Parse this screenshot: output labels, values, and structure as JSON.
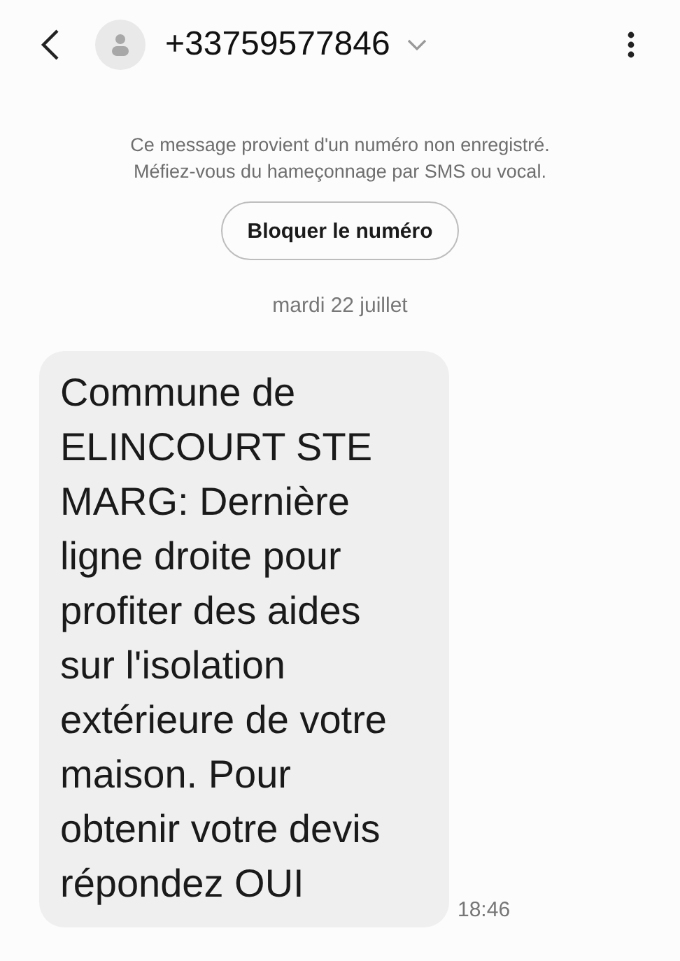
{
  "header": {
    "contact": "+33759577846"
  },
  "notice": {
    "text": "Ce message provient d'un numéro non enregistré. Méfiez-vous du hameçonnage par SMS ou vocal.",
    "button": "Bloquer le numéro"
  },
  "date": "mardi 22 juillet",
  "messages": [
    {
      "text": "Commune de ELINCOURT STE MARG: Dernière ligne droite pour profiter des aides sur l'isolation extérieure de votre maison. Pour obtenir votre devis répondez OUI",
      "time": "18:46"
    }
  ]
}
